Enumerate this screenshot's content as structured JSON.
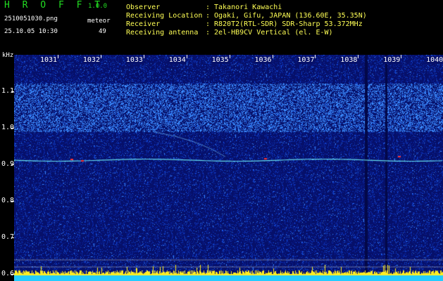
{
  "header": {
    "app_name": "H R O F F T",
    "version": "1.0.0",
    "filename": "2510051030.png",
    "datetime": "25.10.05 10:30",
    "meteor_label": "meteor",
    "meteor_count": "49"
  },
  "info": [
    {
      "key": "Observer",
      "sep": ":",
      "value": "Takanori Kawachi"
    },
    {
      "key": "Receiving Location",
      "sep": ":",
      "value": "Ogaki, Gifu, JAPAN (136.60E, 35.35N)"
    },
    {
      "key": "Receiver",
      "sep": ":",
      "value": "R820T2(RTL-SDR) SDR-Sharp 53.372MHz"
    },
    {
      "key": "Receiving antenna",
      "sep": ":",
      "value": "2el-HB9CV Vertical (el. E-W)"
    }
  ],
  "chart_data": {
    "type": "heatmap",
    "ylabel": "kHz",
    "y_ticks": [
      "1.1",
      "1.0",
      "0.9",
      "0.8",
      "0.7",
      "0.6"
    ],
    "x_ticks": [
      "1031",
      "1032",
      "1033",
      "1034",
      "1035",
      "1036",
      "1037",
      "1038",
      "1039",
      "1040"
    ],
    "ylim": [
      0.58,
      1.2
    ],
    "colors": {
      "background": "#06106a",
      "noise": "#1f6bff",
      "carrier": "#66ddee",
      "meteor": "#ff3333",
      "bottom_band": "#ffee22"
    }
  }
}
